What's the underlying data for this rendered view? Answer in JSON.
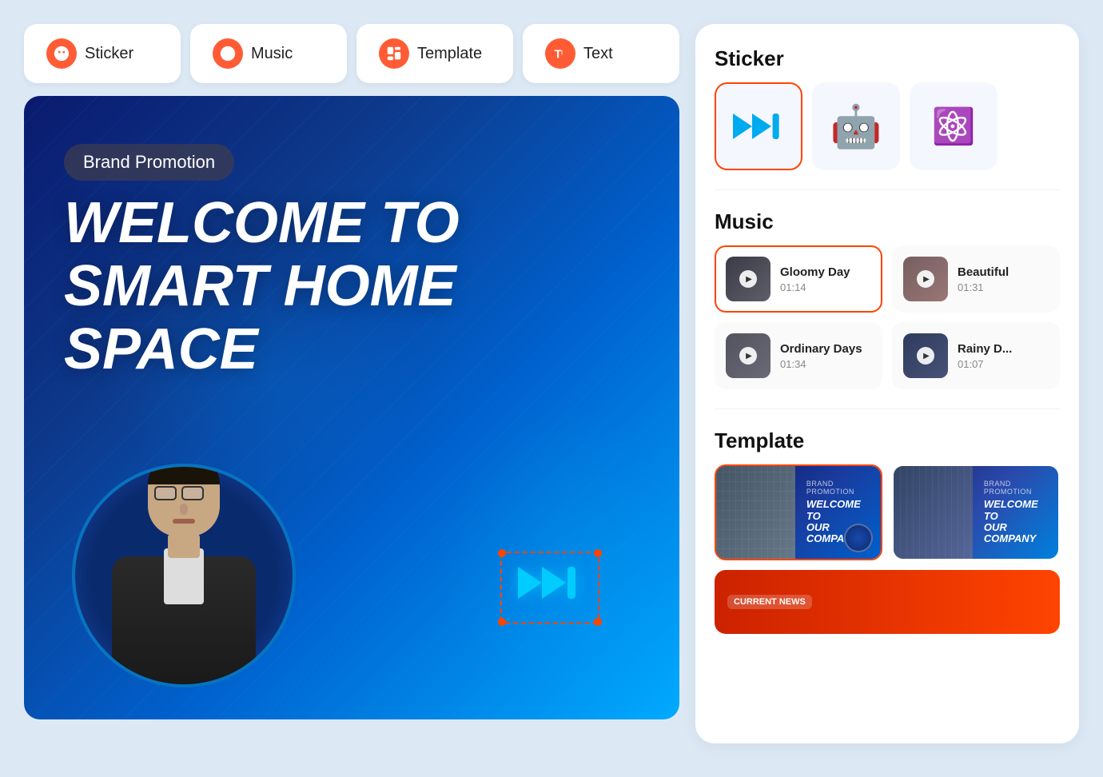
{
  "toolbar": {
    "buttons": [
      {
        "id": "sticker",
        "label": "Sticker",
        "icon": "sticker-icon"
      },
      {
        "id": "music",
        "label": "Music",
        "icon": "music-icon"
      },
      {
        "id": "template",
        "label": "Template",
        "icon": "template-icon"
      },
      {
        "id": "text",
        "label": "Text",
        "icon": "text-icon"
      }
    ]
  },
  "canvas": {
    "brand_badge": "Brand Promotion",
    "title_line1": "WELCOME TO",
    "title_line2": "SMART HOME SPACE"
  },
  "right_panel": {
    "sticker_section": {
      "title": "Sticker",
      "items": [
        {
          "id": "ff-arrows",
          "selected": true
        },
        {
          "id": "robot",
          "emoji": "🤖"
        },
        {
          "id": "atom",
          "emoji": "⚛️"
        }
      ]
    },
    "music_section": {
      "title": "Music",
      "items": [
        {
          "id": "gloomy",
          "name": "Gloomy Day",
          "duration": "01:14",
          "selected": true,
          "thumb_class": "thumb-gloomy"
        },
        {
          "id": "beautiful",
          "name": "Beautiful",
          "duration": "01:31",
          "selected": false,
          "thumb_class": "thumb-beautiful"
        },
        {
          "id": "ordinary",
          "name": "Ordinary Days",
          "duration": "01:34",
          "selected": false,
          "thumb_class": "thumb-ordinary"
        },
        {
          "id": "rainy",
          "name": "Rainy D...",
          "duration": "01:07",
          "selected": false,
          "thumb_class": "thumb-rainy"
        }
      ]
    },
    "template_section": {
      "title": "Template",
      "items": [
        {
          "id": "tpl1",
          "badge": "Brand Promotion",
          "headline": "WELCOME TO\nOUR COMPANY",
          "selected": true
        },
        {
          "id": "tpl2",
          "badge": "Brand Promotion",
          "headline": "WELCOME TO\nOUR COMPANY",
          "selected": false
        }
      ],
      "news_item": {
        "label": "CURRENT NEWS"
      }
    }
  }
}
